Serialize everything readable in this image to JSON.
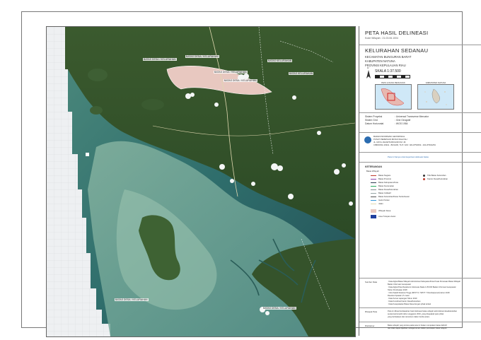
{
  "map": {
    "labels": [
      {
        "key": "a",
        "text": "BATAS DESA / KELURAHAN"
      },
      {
        "key": "b",
        "text": "BATAS DESA / KELURAHAN"
      },
      {
        "key": "c",
        "text": "BATAS KELURAHAN"
      },
      {
        "key": "d",
        "text": "BATAS DESA / KELURAHAN"
      },
      {
        "key": "e",
        "text": "BATAS DESA / KELURAHAN"
      },
      {
        "key": "f",
        "text": "BATAS KELURAHAN"
      },
      {
        "key": "g",
        "text": "BATAS DESA / KELURAHAN"
      },
      {
        "key": "h",
        "text": "BATAS DESA / KELURAHAN"
      }
    ]
  },
  "title": {
    "main": "PETA HASIL DELINEASI",
    "code": "Kode Wilayah : 21.03.06.1004"
  },
  "area": {
    "name": "KELURAHAN SEDANAU",
    "kecamatan": "KECAMATAN BUNGURAN BARAT",
    "kabupaten": "KABUPATEN NATUNA",
    "provinsi": "PROVINSI KEPULAUAN RIAU"
  },
  "scale": {
    "label": "SKALA  1:37.500",
    "north_symbol": "U"
  },
  "insets": {
    "left_title": "PETA LOKASI PENUNJUK",
    "right_title": "KABUPATEN NATUNA"
  },
  "projection": {
    "rows": [
      {
        "k": "Sistem Proyeksi",
        "v": ": Universal Transverse Mercator"
      },
      {
        "k": "Sistem Grid",
        "v": ": Grid Geografi"
      },
      {
        "k": "Datum Horizontal",
        "v": ": WGS 1984"
      }
    ]
  },
  "agency": {
    "lines": [
      "BADAN INFORMASI GEOSPASIAL",
      "PUSAT PEMETAAN BATAS WILAYAH",
      "JL. RAYA JAKARTA BOGOR KM. 46",
      "CIBINONG 16911 - BOGOR, TLP / FAX: 021-8752062 - 021-87901254"
    ]
  },
  "note": "Peta ini hanya untuk keperluan delineasi batas",
  "legend": {
    "title": "KETERANGAN",
    "sub": "Batas Wilayah",
    "items": [
      {
        "text": "Batas Negara",
        "color": "#c0392b"
      },
      {
        "text": "Batas Provinsi",
        "color": "#8e44ad"
      },
      {
        "text": "Batas Kabupaten/Kota",
        "color": "#2c3e50"
      },
      {
        "text": "Batas Kecamatan",
        "color": "#27ae60"
      },
      {
        "text": "Batas Desa/Kelurahan",
        "color": "#7f8c8d"
      },
      {
        "text": "Batas Indikatif",
        "color": "#95a5a6"
      },
      {
        "text": "Batas Kelurahan/Desa Terdelineasi",
        "color": "#555555"
      },
      {
        "text": "Garis Pantai",
        "color": "#3498db"
      },
      {
        "text": "Jalan",
        "color": "#e0d8b0"
      }
    ],
    "area_items": [
      {
        "text": "Wilayah Desa",
        "color": "#e8c8c0"
      },
      {
        "text": "Area Tutupan Awan",
        "color": "#1f3f9f"
      }
    ],
    "right_items": [
      {
        "text": "Titik Batas Kelurahan",
        "color": "#333333"
      },
      {
        "text": "Kantor Desa/Kelurahan",
        "color": "#c0392b"
      }
    ]
  },
  "sources": {
    "label": "Sumber Data",
    "lines": [
      ": Data digital Batas Wilayah Administrasi Kabupaten/Kota Pusat Pemetaan Batas Wilayah",
      "  Badan Informasi Geospasial",
      ": Data digital Peta Rupabumi Indonesia Skala 1:25.000 Badan Informasi Geospasial",
      "  Tahun Pembuatan 2018",
      ": Citra Satelit Resolusi Tinggi (SPOT 6 / SPOT 7 Pansharpened) tahun 2018",
      "  Resolusi Spasial 1,5 meter",
      ": Data Survei Lapangan Tahun 2019",
      ": Data Koordinat Kantor Desa/Kelurahan",
      ": Data Kesepakatan Batas Desa dengan pihak terkait"
    ]
  },
  "riwayat": {
    "label": "Riwayat Peta",
    "lines": [
      "Peta ini dibuat berdasarkan hasil delineasi batas wilayah administrasi desa/kelurahan",
      "secara kartometrik tahun anggaran 2019, yang disepakati para pihak",
      "yang berbatasan dan tercantum dalam berita acara."
    ]
  },
  "disclaimer": {
    "label": "Disclaimer",
    "lines": [
      "Batas wilayah yang tertera pada peta ini bukan merupakan batas definitif",
      "dan tidak dapat dijadikan sebagai acuan dalam penetapan batas wilayah."
    ]
  }
}
